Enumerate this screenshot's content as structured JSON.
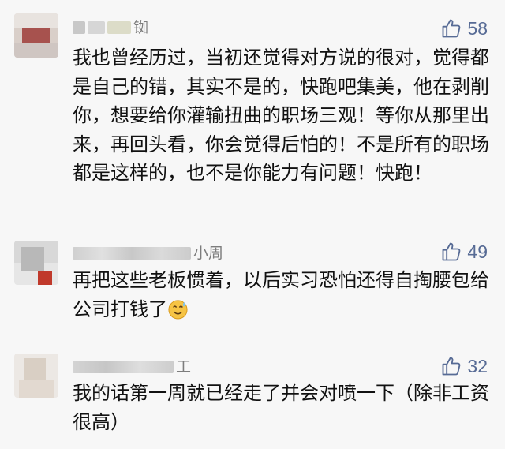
{
  "comments": [
    {
      "name_visible": "铷",
      "likes": "58",
      "text": "我也曾经历过，当初还觉得对方说的很对，觉得都是自己的错，其实不是的，快跑吧集美，他在剥削你，想要给你灌输扭曲的职场三观！等你从那里出来，再回头看，你会觉得后怕的！不是所有的职场都是这样的，也不是你能力有问题！快跑！"
    },
    {
      "name_visible": "小周",
      "likes": "49",
      "text": "再把这些老板惯着，以后实习恐怕还得自掏腰包给公司打钱了",
      "emoji": "sweat-smile-emoji"
    },
    {
      "name_visible": "工",
      "likes": "32",
      "text": "我的话第一周就已经走了并会对喷一下（除非工资很高）"
    }
  ],
  "colors": {
    "background": "#f7f7f7",
    "like_accent": "#576b95",
    "name_gray": "#7d7d7d",
    "text": "#111111"
  },
  "icons": [
    "thumbs-up-icon"
  ]
}
